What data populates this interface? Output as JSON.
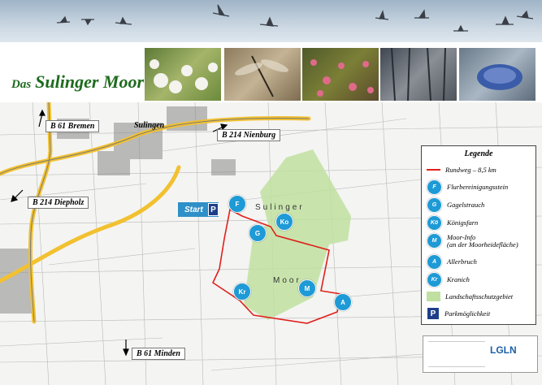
{
  "title": {
    "prefix": "Das",
    "name": "Sulinger Moor"
  },
  "photos": [
    "cotton-grass",
    "dragonfly",
    "cranberry-heath",
    "bog-forest",
    "moor-frog"
  ],
  "roads": {
    "b61_north": "B 61 Bremen",
    "town": "Sulingen",
    "b214_east": "B 214 Nienburg",
    "b214_west": "B 214 Diepholz",
    "b61_south": "B 61 Minden"
  },
  "start": {
    "label": "Start",
    "parking": "P"
  },
  "map_markers": [
    "F",
    "Ko",
    "G",
    "Kr",
    "M",
    "A"
  ],
  "map_text": {
    "sulinger": "Sulinger",
    "moor": "Moor"
  },
  "legend": {
    "title": "Legende",
    "route": "Rundweg – 8,5 km",
    "items": [
      {
        "code": "F",
        "text": "Flurbereinigungsstein"
      },
      {
        "code": "G",
        "text": "Gagelstrauch"
      },
      {
        "code": "Kö",
        "text": "Königsfarn"
      },
      {
        "code": "M",
        "text": "Moor-Info",
        "sub": "(an der Moorheidefläche)"
      },
      {
        "code": "A",
        "text": "Allerbruch"
      },
      {
        "code": "Kr",
        "text": "Kranich"
      }
    ],
    "protected_area": "Landschaftsschutzgebiet",
    "parking": "Parkmöglichkeit",
    "parking_symbol": "P"
  },
  "colors": {
    "route": "#e0201c",
    "marker": "#1e9ad6",
    "protected": "#bfe0a0",
    "road": "#f2c130",
    "title": "#1d6b1d"
  },
  "footer": {
    "logo": "LGLN"
  }
}
